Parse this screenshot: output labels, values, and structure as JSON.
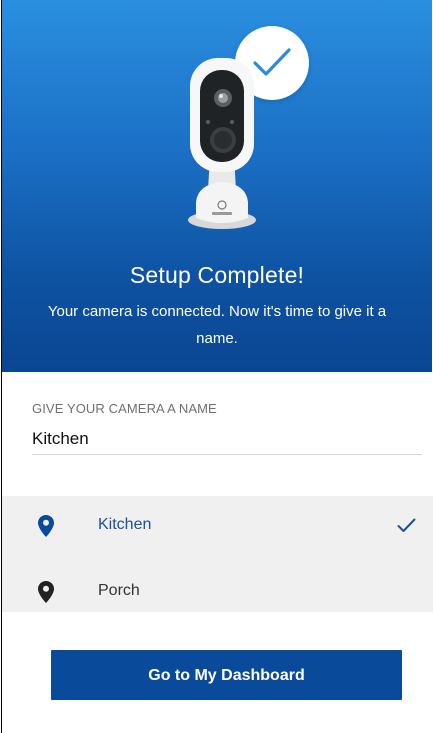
{
  "hero": {
    "title": "Setup Complete!",
    "subtitle": "Your camera is connected. Now it's time to give it a name."
  },
  "name_field": {
    "label": "GIVE YOUR CAMERA A NAME",
    "value": "Kitchen"
  },
  "locations": [
    {
      "label": "Kitchen",
      "selected": true,
      "icon": "location-pin-icon"
    },
    {
      "label": "Porch",
      "selected": false,
      "icon": "location-pin-icon"
    }
  ],
  "cta": {
    "label": "Go to My Dashboard"
  },
  "colors": {
    "brand_blue": "#0a4a9a",
    "hero_top": "#2b8fe0",
    "hero_bottom": "#0a4692",
    "selected_text": "#1a4f9c",
    "list_bg": "#f0f0f0"
  }
}
